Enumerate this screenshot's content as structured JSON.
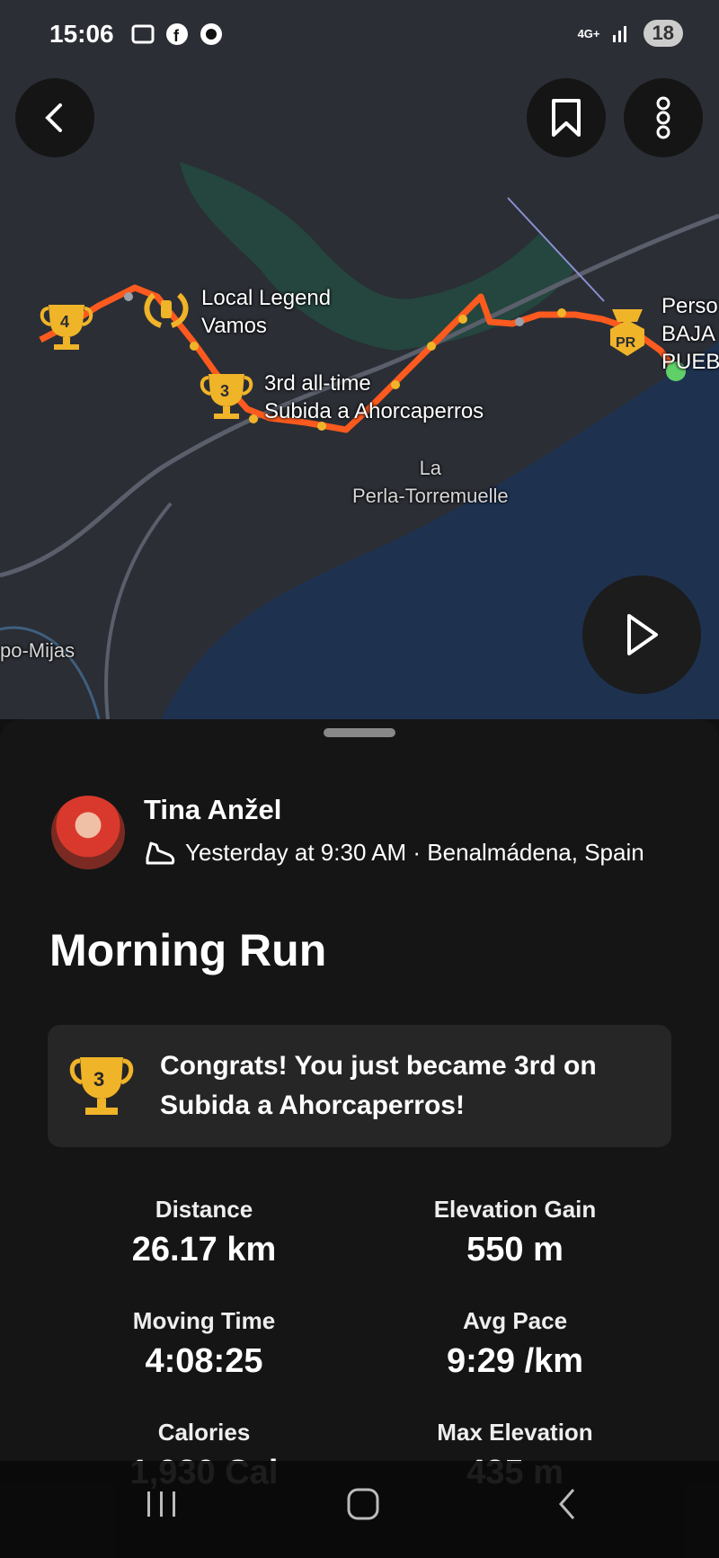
{
  "status_bar": {
    "time": "15:06",
    "network": "4G+",
    "battery": "18"
  },
  "map": {
    "labels": {
      "local_legend": [
        "Local Legend",
        "Vamos"
      ],
      "third": [
        "3rd all-time",
        "Subida a Ahorcaperros"
      ],
      "place1": [
        "La",
        "Perla-Torremuelle"
      ],
      "place2": "po-Mijas",
      "pr_cut": [
        "Perso",
        "BAJA",
        "PUEB"
      ]
    },
    "trophy_rank_left": "4",
    "trophy_rank_mid": "3",
    "pr_badge": "PR"
  },
  "activity": {
    "author": "Tina Anžel",
    "meta": "Yesterday at 9:30 AM · Benalmádena, Spain",
    "title": "Morning Run",
    "congrats": "Congrats! You just became 3rd on Subida a Ahorcaperros!",
    "congrats_rank": "3"
  },
  "stats": {
    "distance_label": "Distance",
    "distance": "26.17 km",
    "elev_label": "Elevation Gain",
    "elev": "550 m",
    "moving_label": "Moving Time",
    "moving": "4:08:25",
    "pace_label": "Avg Pace",
    "pace": "9:29 /km",
    "cal_label": "Calories",
    "cal": "1,930 Cal",
    "maxelev_label": "Max Elevation",
    "maxelev": "435 m"
  },
  "colors": {
    "route": "#fc5a1e",
    "trophy": "#f0b429",
    "sea": "#1e3250"
  }
}
